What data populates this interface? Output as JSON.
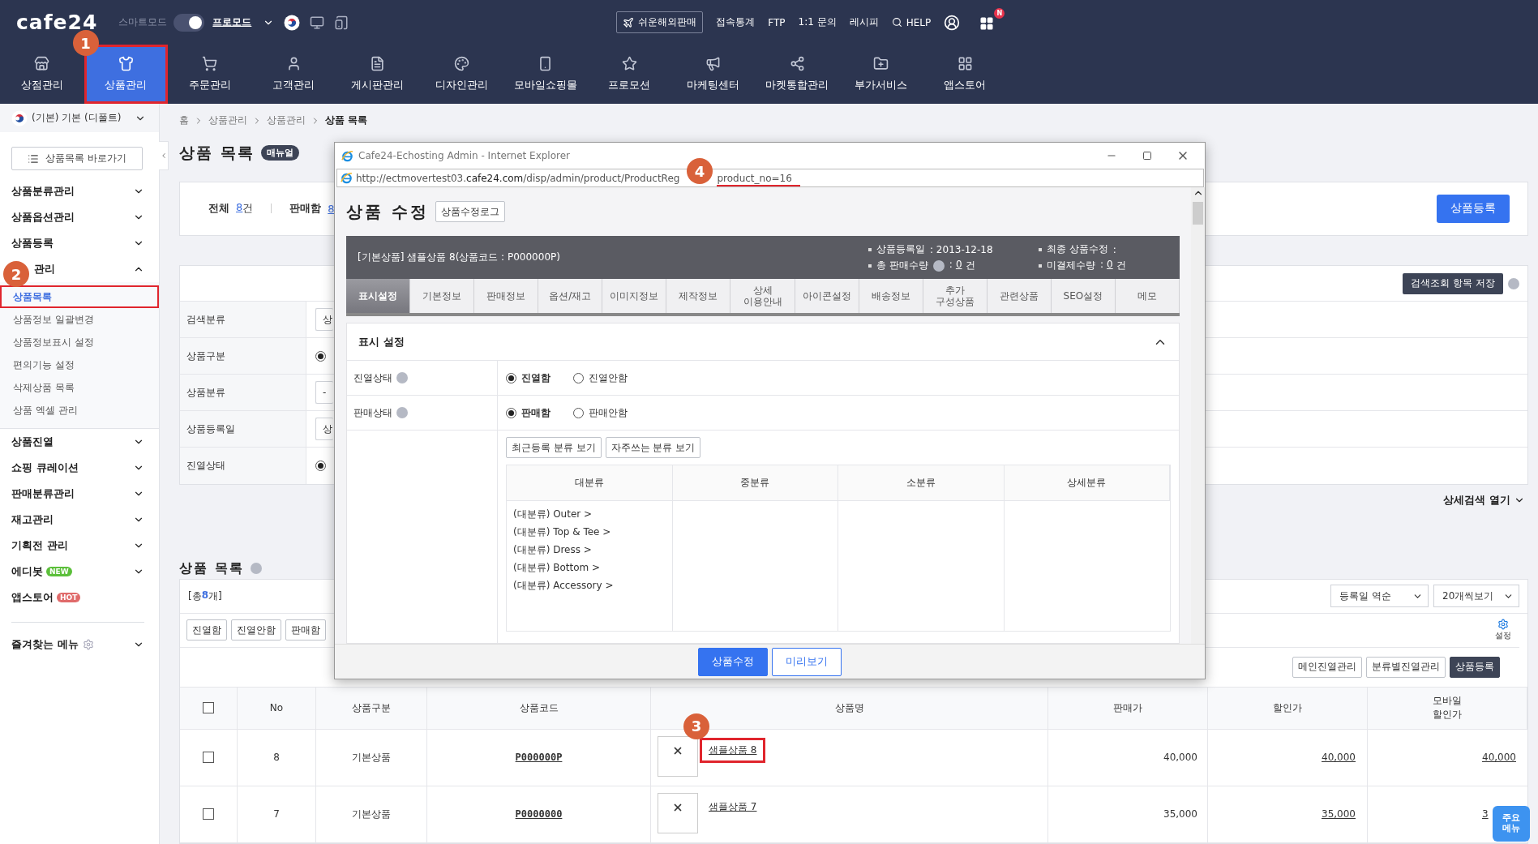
{
  "header": {
    "logo": "cafe24",
    "smart_mode": {
      "label": "스마트모드",
      "on": true
    },
    "mode": "프로모드",
    "global_button": "쉬운해외판매",
    "links": [
      "접속통계",
      "FTP",
      "1:1 문의",
      "레시피"
    ],
    "help": "HELP",
    "apps_badge": "N",
    "nav": [
      {
        "label": "상점관리",
        "selected": false,
        "highlighted": false
      },
      {
        "label": "상품관리",
        "selected": true,
        "highlighted": true
      },
      {
        "label": "주문관리",
        "selected": false,
        "highlighted": false
      },
      {
        "label": "고객관리",
        "selected": false,
        "highlighted": false
      },
      {
        "label": "게시판관리",
        "selected": false,
        "highlighted": false
      },
      {
        "label": "디자인관리",
        "selected": false,
        "highlighted": false
      },
      {
        "label": "모바일쇼핑몰",
        "selected": false,
        "highlighted": false
      },
      {
        "label": "프로모션",
        "selected": false,
        "highlighted": false
      },
      {
        "label": "마케팅센터",
        "selected": false,
        "highlighted": false
      },
      {
        "label": "마켓통합관리",
        "selected": false,
        "highlighted": false
      },
      {
        "label": "부가서비스",
        "selected": false,
        "highlighted": false
      },
      {
        "label": "앱스토어",
        "selected": false,
        "highlighted": false
      }
    ]
  },
  "callouts": [
    "1",
    "2",
    "3",
    "4"
  ],
  "sidebar": {
    "store": "(기본) 기본 (디폴트)",
    "shortcut": "상품목록 바로가기",
    "groups": [
      {
        "label": "상품분류관리",
        "expanded": false
      },
      {
        "label": "상품옵션관리",
        "expanded": false
      },
      {
        "label": "상품등록",
        "expanded": false
      },
      {
        "label": "관리",
        "expanded": true,
        "children": [
          {
            "label": "상품목록",
            "selected": true,
            "highlighted": true
          },
          {
            "label": "상품정보 일괄변경",
            "selected": false,
            "highlighted": false
          },
          {
            "label": "상품정보표시 설정",
            "selected": false,
            "highlighted": false
          },
          {
            "label": "편의기능 설정",
            "selected": false,
            "highlighted": false
          },
          {
            "label": "삭제상품 목록",
            "selected": false,
            "highlighted": false
          },
          {
            "label": "상품 엑셀 관리",
            "selected": false,
            "highlighted": false
          }
        ]
      },
      {
        "label": "상품진열",
        "expanded": false
      },
      {
        "label": "쇼핑 큐레이션",
        "expanded": false
      },
      {
        "label": "판매분류관리",
        "expanded": false
      },
      {
        "label": "재고관리",
        "expanded": false
      },
      {
        "label": "기획전 관리",
        "expanded": false
      },
      {
        "label": "에디봇",
        "expanded": false,
        "badge": {
          "text": "NEW",
          "color": "#5bbf3a"
        }
      },
      {
        "label": "앱스토어",
        "badge": {
          "text": "HOT",
          "color": "#e06a6a"
        }
      }
    ],
    "favorites": "즐겨찾는 메뉴"
  },
  "breadcrumb": [
    "홈",
    "상품관리",
    "상품관리",
    "상품 목록"
  ],
  "page_title": "상품 목록",
  "manual_badge": "매뉴얼",
  "summary": {
    "items": [
      {
        "label": "전체",
        "count": "8",
        "unit": "건"
      },
      {
        "label": "판매함",
        "count": "8"
      }
    ],
    "register_button": "상품등록"
  },
  "search": {
    "save_button": "검색조회 항목 저장",
    "rows": [
      {
        "label": "검색분류",
        "kind": "select",
        "value": "상"
      },
      {
        "label": "상품구분",
        "kind": "radio",
        "selected": true
      },
      {
        "label": "상품분류",
        "kind": "select",
        "value": "-"
      },
      {
        "label": "상품등록일",
        "kind": "select",
        "value": "상"
      },
      {
        "label": "진열상태",
        "kind": "radio",
        "selected": true
      }
    ],
    "detail_toggle": "상세검색 열기"
  },
  "list": {
    "title": "상품 목록",
    "total_prefix": "[총 ",
    "total": "8",
    "total_suffix": "개]",
    "sort": "등록일 역순",
    "page_size": "20개씩보기",
    "actions": [
      "진열함",
      "진열안함",
      "판매함"
    ],
    "settings": "설정",
    "buttons": [
      {
        "label": "메인진열관리",
        "kind": "default"
      },
      {
        "label": "분류별진열관리",
        "kind": "default"
      },
      {
        "label": "상품등록",
        "kind": "dark"
      }
    ],
    "all_checked": false,
    "columns": [
      "No",
      "상품구분",
      "상품코드",
      "상품명",
      "판매가",
      "할인가",
      "모바일\n할인가"
    ],
    "rows": [
      {
        "checked": false,
        "no": "8",
        "type": "기본상품",
        "code": "P000000P",
        "name": "샘플상품 8",
        "highlighted": true,
        "price": "40,000",
        "sale": "40,000",
        "mobile_sale": "40,000"
      },
      {
        "checked": false,
        "no": "7",
        "type": "기본상품",
        "code": "P0000000",
        "name": "샘플상품 7",
        "highlighted": false,
        "price": "35,000",
        "sale": "35,000",
        "mobile_sale": "3"
      }
    ]
  },
  "popup": {
    "title": "Cafe24-Echosting Admin - Internet Explorer",
    "url": {
      "prefix": "http://ectmovertest03.",
      "domain": "cafe24.com",
      "path": "/disp/admin/product/ProductReg",
      "tail": "product_no=16",
      "tail_highlighted": true
    },
    "heading": "상품 수정",
    "log_button": "상품수정로그",
    "product": "[기본상품] 샘플상품 8(상품코드 : P000000P)",
    "meta": [
      {
        "label": "상품등록일",
        "value": ": 2013-12-18"
      },
      {
        "label": "최종 상품수정",
        "value": ":"
      },
      {
        "label": "총 판매수량",
        "help": true,
        "prefix": ":",
        "count": "0",
        "unit": "건"
      },
      {
        "label": "미결제수량",
        "prefix": ":",
        "count": "0",
        "unit": "건"
      }
    ],
    "tabs": [
      {
        "label": "표시설정",
        "selected": true
      },
      {
        "label": "기본정보",
        "selected": false
      },
      {
        "label": "판매정보",
        "selected": false
      },
      {
        "label": "옵션/재고",
        "selected": false
      },
      {
        "label": "이미지정보",
        "selected": false
      },
      {
        "label": "제작정보",
        "selected": false
      },
      {
        "label": "상세\n이용안내",
        "selected": false
      },
      {
        "label": "아이콘설정",
        "selected": false
      },
      {
        "label": "배송정보",
        "selected": false
      },
      {
        "label": "추가\n구성상품",
        "selected": false
      },
      {
        "label": "관련상품",
        "selected": false
      },
      {
        "label": "SEO설정",
        "selected": false
      },
      {
        "label": "메모",
        "selected": false
      }
    ],
    "section": {
      "title": "표시 설정",
      "expanded": true,
      "rows": [
        {
          "label": "진열상태",
          "options": [
            {
              "label": "진열함",
              "selected": true
            },
            {
              "label": "진열안함",
              "selected": false
            }
          ]
        },
        {
          "label": "판매상태",
          "options": [
            {
              "label": "판매함",
              "selected": true
            },
            {
              "label": "판매안함",
              "selected": false
            }
          ]
        }
      ],
      "category_buttons": [
        "최근등록 분류 보기",
        "자주쓰는 분류 보기"
      ],
      "category_columns": [
        "대분류",
        "중분류",
        "소분류",
        "상세분류"
      ],
      "categories": [
        "(대분류) Outer >",
        "(대분류) Top & Tee >",
        "(대분류) Dress >",
        "(대분류) Bottom >",
        "(대분류) Accessory >"
      ]
    },
    "footer_buttons": [
      {
        "label": "상품수정",
        "kind": "primary"
      },
      {
        "label": "미리보기",
        "kind": "secondary"
      }
    ]
  },
  "quick_menu": [
    "주요",
    "메뉴"
  ]
}
